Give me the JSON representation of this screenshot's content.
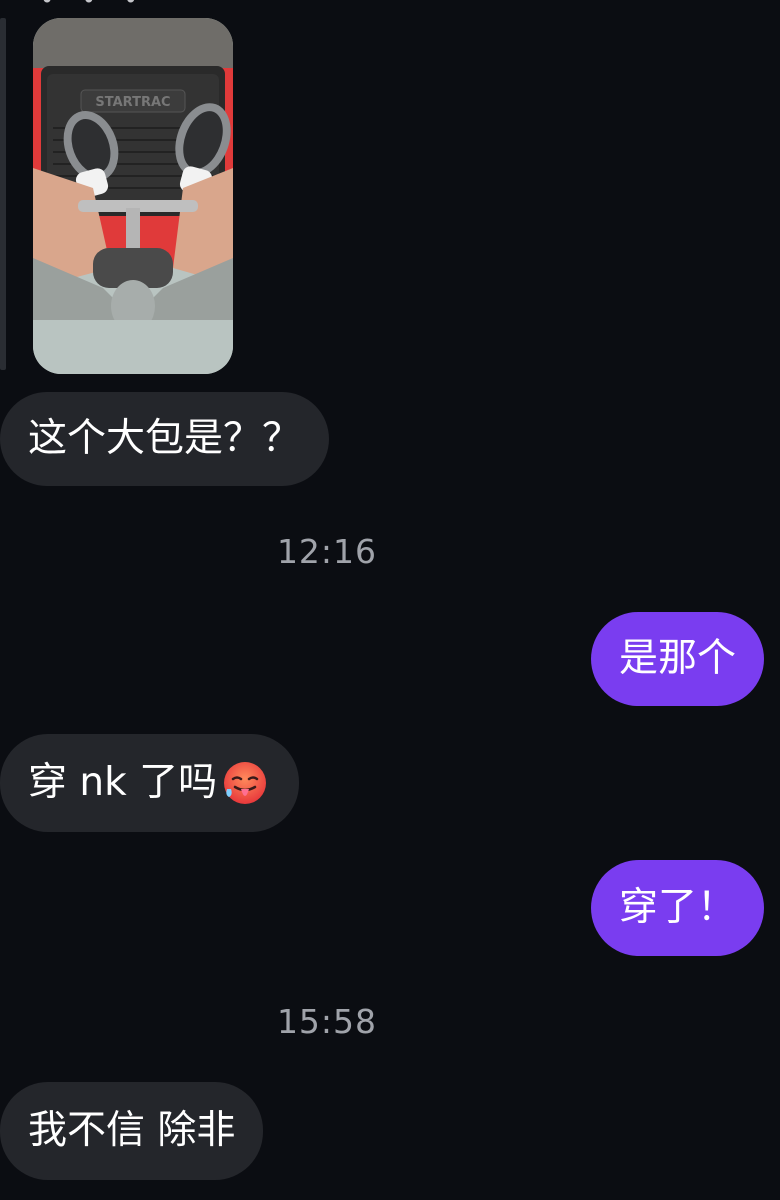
{
  "chat": {
    "top_partial": "• • •",
    "messages": [
      {
        "type": "image",
        "direction": "incoming",
        "alt": "photo of a leg press machine with STARTRAC label"
      },
      {
        "type": "text",
        "direction": "incoming",
        "text": "这个大包是？？"
      },
      {
        "type": "timestamp",
        "text": "12:16"
      },
      {
        "type": "text",
        "direction": "outgoing",
        "text": "是那个"
      },
      {
        "type": "text",
        "direction": "incoming",
        "text": "穿 nk 了吗",
        "emoji": "hot-face-emoji"
      },
      {
        "type": "text",
        "direction": "outgoing",
        "text": "穿了！"
      },
      {
        "type": "timestamp",
        "text": "15:58"
      },
      {
        "type": "text",
        "direction": "incoming",
        "text": "我不信 除非"
      }
    ],
    "photo_label": "STARTRAC"
  },
  "colors": {
    "background": "#0b0d12",
    "incoming_bubble": "#24262b",
    "outgoing_bubble": "#7a3df0",
    "timestamp_text": "#a0a3aa"
  }
}
